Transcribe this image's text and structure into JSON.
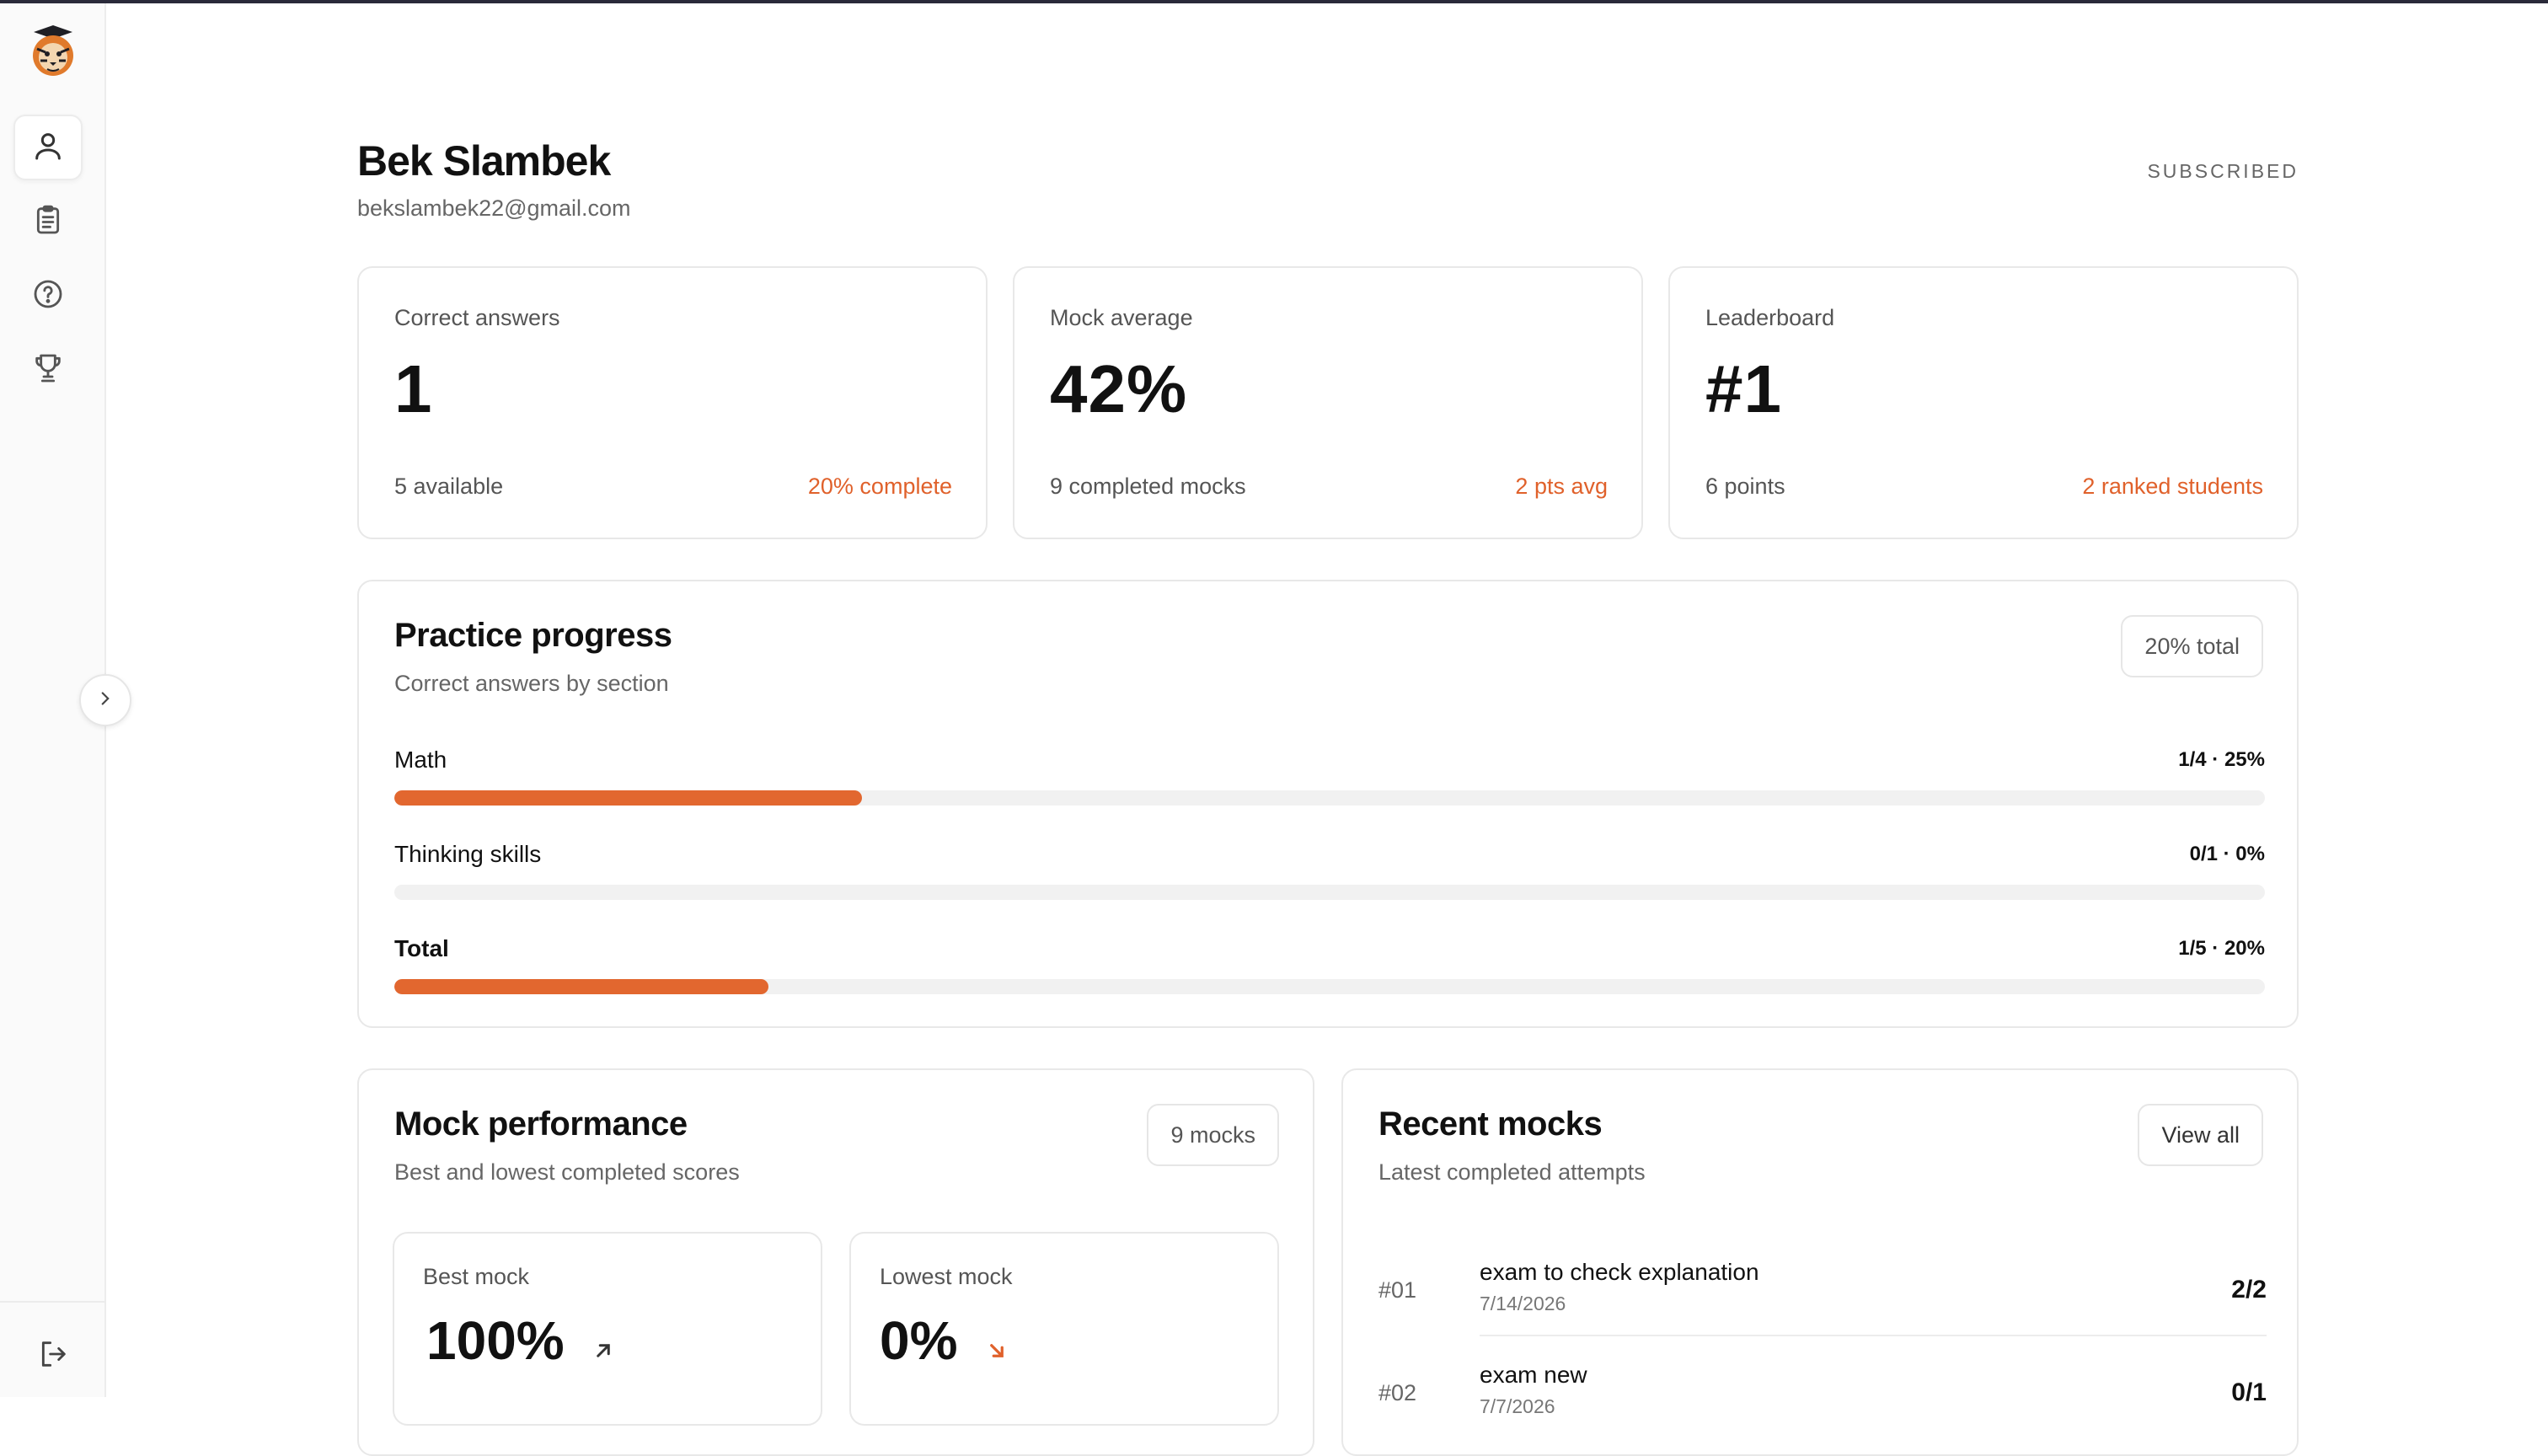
{
  "profile": {
    "name": "Bek Slambek",
    "email": "bekslambek22@gmail.com",
    "status": "SUBSCRIBED"
  },
  "stats": [
    {
      "label": "Correct answers",
      "value": "1",
      "sub": "5 available",
      "accent": "20% complete"
    },
    {
      "label": "Mock average",
      "value": "42%",
      "sub": "9 completed mocks",
      "accent": "2 pts avg"
    },
    {
      "label": "Leaderboard",
      "value": "#1",
      "sub": "6 points",
      "accent": "2 ranked students"
    }
  ],
  "practice": {
    "title": "Practice progress",
    "subtitle": "Correct answers by section",
    "badge": "20% total",
    "rows": [
      {
        "label": "Math",
        "value": "1/4 · 25%",
        "progress": 0.25
      },
      {
        "label": "Thinking skills",
        "value": "0/1 · 0%",
        "progress": 0
      },
      {
        "label": "Total",
        "value": "1/5 · 20%",
        "progress": 0.2
      }
    ]
  },
  "mock_performance": {
    "title": "Mock performance",
    "subtitle": "Best and lowest completed scores",
    "badge": "9 mocks",
    "best_label": "Best mock",
    "best_value": "100%",
    "lowest_label": "Lowest mock",
    "lowest_value": "0%"
  },
  "recent_mocks": {
    "title": "Recent mocks",
    "subtitle": "Latest completed attempts",
    "view_all": "View all",
    "items": [
      {
        "num": "#01",
        "name": "exam to check explanation",
        "date": "7/14/2026",
        "score": "2/2"
      },
      {
        "num": "#02",
        "name": "exam new",
        "date": "7/7/2026",
        "score": "0/1"
      }
    ]
  },
  "colors": {
    "accent": "#e0612b",
    "bar_fill": "#e2672f",
    "track": "#f1f1f1"
  },
  "icons": {
    "nav": [
      "user-icon",
      "clipboard-icon",
      "help-circle-icon",
      "trophy-icon"
    ],
    "logout": "logout-icon",
    "collapse": "chevron-right-icon"
  }
}
